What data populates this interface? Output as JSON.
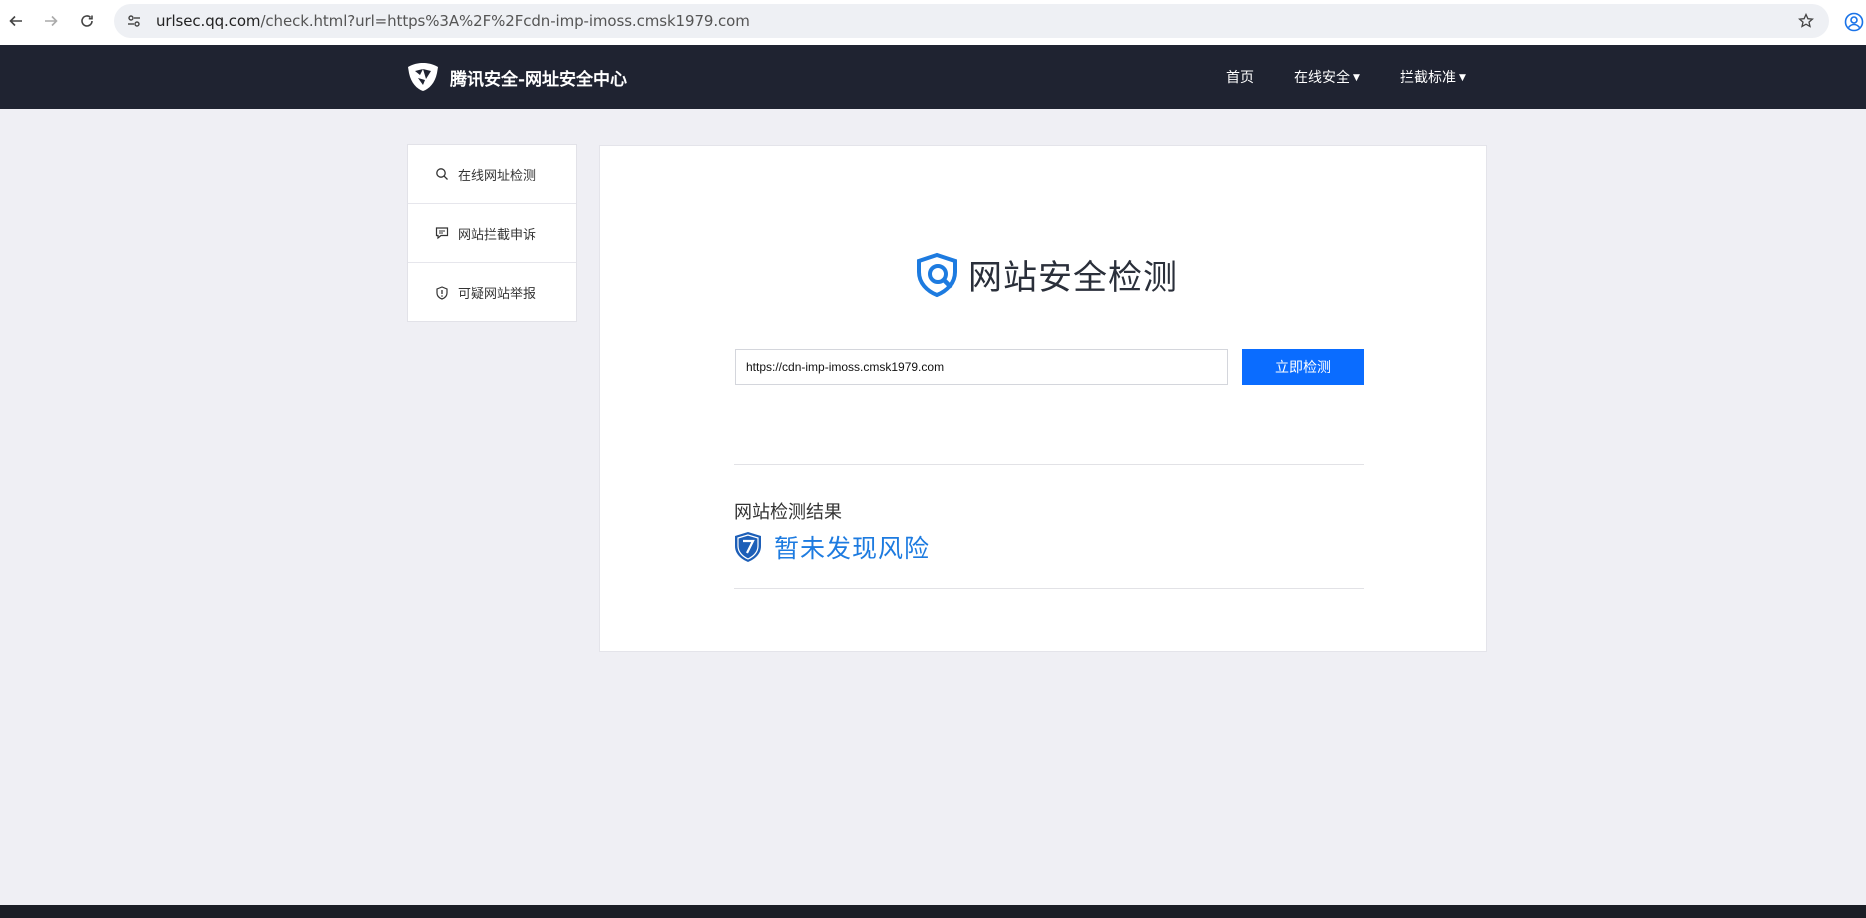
{
  "browser": {
    "url_host": "urlsec.qq.com",
    "url_rest": "/check.html?url=https%3A%2F%2Fcdn-imp-imoss.cmsk1979.com"
  },
  "header": {
    "site_title": "腾讯安全-网址安全中心",
    "nav": [
      {
        "label": "首页",
        "icon": null
      },
      {
        "label": "在线安全",
        "icon": "caret-down-icon"
      },
      {
        "label": "拦截标准",
        "icon": "caret-down-icon"
      }
    ]
  },
  "sidebar": {
    "items": [
      {
        "label": "在线网址检测",
        "icon": "search-icon"
      },
      {
        "label": "网站拦截申诉",
        "icon": "chat-bubble-icon"
      },
      {
        "label": "可疑网站举报",
        "icon": "shield-exclamation-icon"
      }
    ]
  },
  "main": {
    "title": "网站安全检测",
    "search_value": "https://cdn-imp-imoss.cmsk1979.com",
    "check_button": "立即检测",
    "result_label": "网站检测结果",
    "result_text": "暂未发现风险"
  },
  "colors": {
    "header_bg": "#1f2331",
    "accent_blue": "#0a6cff",
    "result_blue": "#1d7be0",
    "page_bg": "#efeff4"
  }
}
